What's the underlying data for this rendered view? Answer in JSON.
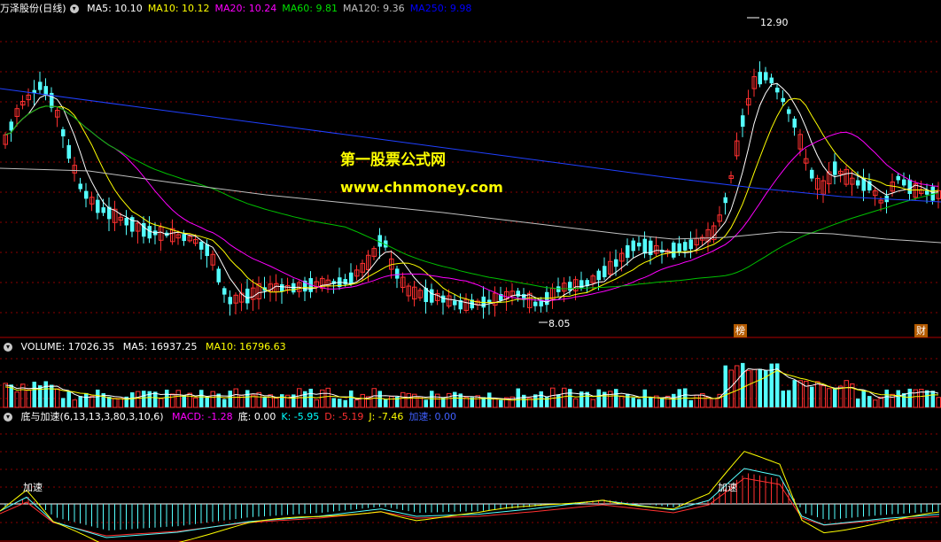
{
  "main": {
    "title": "万泽股份(日线)",
    "ma": [
      {
        "label": "MA5: 10.10",
        "color": "#ffffff"
      },
      {
        "label": "MA10: 10.12",
        "color": "#ffff00"
      },
      {
        "label": "MA20: 10.24",
        "color": "#ff00ff"
      },
      {
        "label": "MA60: 9.81",
        "color": "#00e000"
      },
      {
        "label": "MA120: 9.36",
        "color": "#c0c0c0"
      },
      {
        "label": "MA250: 9.98",
        "color": "#0000ff"
      }
    ],
    "high_label": "12.90",
    "low_label": "8.05",
    "event_marks": [
      "榜",
      "财"
    ]
  },
  "watermark": {
    "line1": "第一股票公式网",
    "line2": "www.chnmoney.com"
  },
  "volume": {
    "title": "VOLUME: 17026.35",
    "ma5": "MA5: 16937.25",
    "ma10": "MA10: 16796.63"
  },
  "indicator": {
    "title": "底与加速(6,13,13,3,80,3,10,6)",
    "items": [
      {
        "label": "MACD: -1.28",
        "color": "#ff00ff"
      },
      {
        "label": "底: 0.00",
        "color": "#ffffff"
      },
      {
        "label": "K: -5.95",
        "color": "#00ffff"
      },
      {
        "label": "D: -5.19",
        "color": "#ff3030"
      },
      {
        "label": "J: -7.46",
        "color": "#ffff00"
      },
      {
        "label": "加速: 0.00",
        "color": "#4060ff"
      }
    ],
    "accel_label": "加速"
  },
  "colors": {
    "up": "#ff3030",
    "down": "#54ffff",
    "grid": "#8b0000",
    "panel_border": "#b00000"
  }
}
